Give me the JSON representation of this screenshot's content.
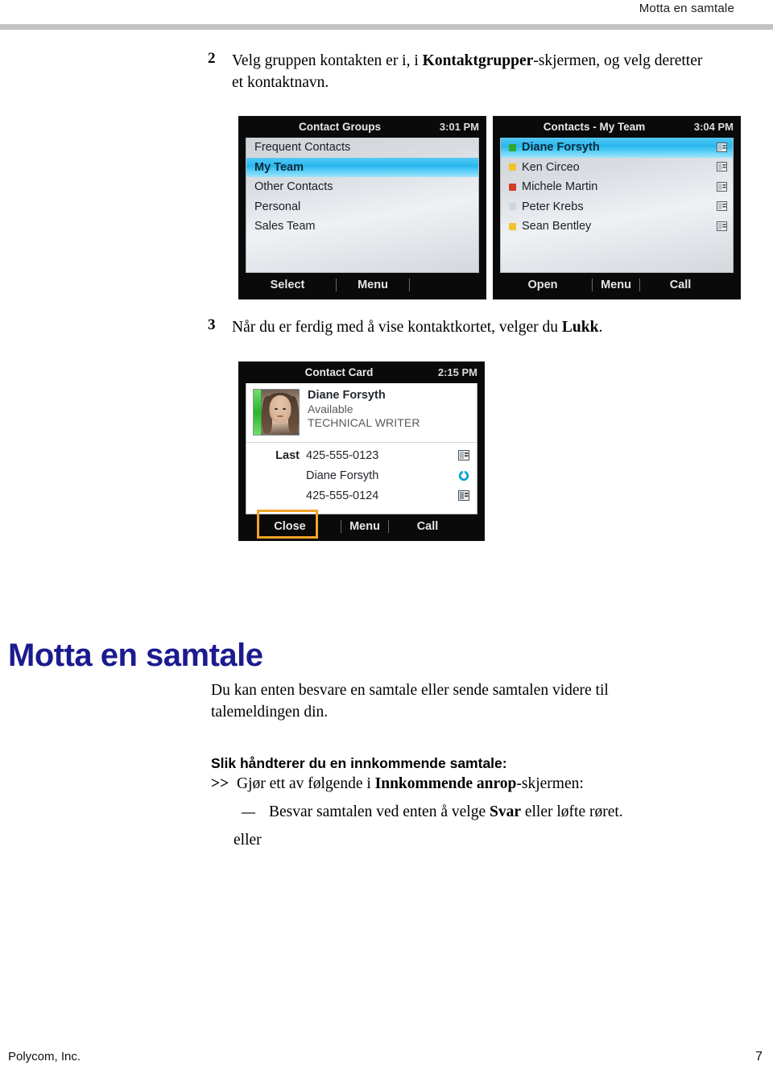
{
  "header": {
    "title": "Motta en samtale"
  },
  "steps": [
    {
      "number": "2",
      "text_part1": "Velg gruppen kontakten er i, i ",
      "bold": "Kontaktgrupper",
      "text_part2": "-skjermen, og velg deretter et kontaktnavn."
    },
    {
      "number": "3",
      "text_part1": "Når du er ferdig med å vise kontaktkortet, velger du ",
      "bold": "Lukk",
      "text_part2": "."
    }
  ],
  "screenshots": {
    "contact_groups": {
      "title": "Contact Groups",
      "time": "3:01 PM",
      "items": [
        {
          "label": "Frequent Contacts",
          "selected": false
        },
        {
          "label": "My Team",
          "selected": true
        },
        {
          "label": "Other Contacts",
          "selected": false
        },
        {
          "label": "Personal",
          "selected": false
        },
        {
          "label": "Sales Team",
          "selected": false
        }
      ],
      "softkeys": [
        "Select",
        "Menu"
      ]
    },
    "contacts_my_team": {
      "title": "Contacts - My Team",
      "time": "3:04 PM",
      "items": [
        {
          "label": "Diane Forsyth",
          "presence": "#2ea82e",
          "selected": true
        },
        {
          "label": "Ken Circeo",
          "presence": "#f2c230",
          "selected": false
        },
        {
          "label": "Michele Martin",
          "presence": "#d23b2a",
          "selected": false
        },
        {
          "label": "Peter Krebs",
          "presence": "#ccd6dd",
          "selected": false
        },
        {
          "label": "Sean Bentley",
          "presence": "#f2c230",
          "selected": false
        }
      ],
      "icon_name": "contact-card-icon",
      "softkeys": [
        "Open",
        "Menu",
        "Call"
      ]
    },
    "contact_card": {
      "title": "Contact Card",
      "time": "2:15 PM",
      "name": "Diane Forsyth",
      "status": "Available",
      "job_title": "TECHNICAL WRITER",
      "presence_color": "#2ea82e",
      "rows": [
        {
          "label": "Last",
          "value": "425-555-0123",
          "icon": "contact-card-icon"
        },
        {
          "label": "",
          "value": "Diane Forsyth",
          "icon": "presence-available-icon"
        },
        {
          "label": "",
          "value": "425-555-0124",
          "icon": "contact-card-icon"
        }
      ],
      "softkeys": [
        "Close",
        "Menu",
        "Call"
      ],
      "highlight_color": "#f0a32a",
      "highlighted_softkey": "Close"
    }
  },
  "section": {
    "heading": "Motta en samtale",
    "heading_color": "#1b1b8f",
    "intro": "Du kan enten besvare en samtale eller sende samtalen videre til talemeldingen din.",
    "sub_heading": "Slik håndterer du en innkommende samtale:",
    "bullet_gjor": {
      "marker": ">>",
      "text_part1": "Gjør ett av følgende i ",
      "bold": "Innkommende anrop",
      "text_part2": "-skjermen:"
    },
    "bullet_besvar": {
      "marker": "—",
      "text_part1": "Besvar samtalen ved enten å velge ",
      "bold": "Svar",
      "text_part2": " eller løfte røret."
    },
    "eller": "eller"
  },
  "footer": {
    "company": "Polycom, Inc.",
    "page_number": "7"
  }
}
